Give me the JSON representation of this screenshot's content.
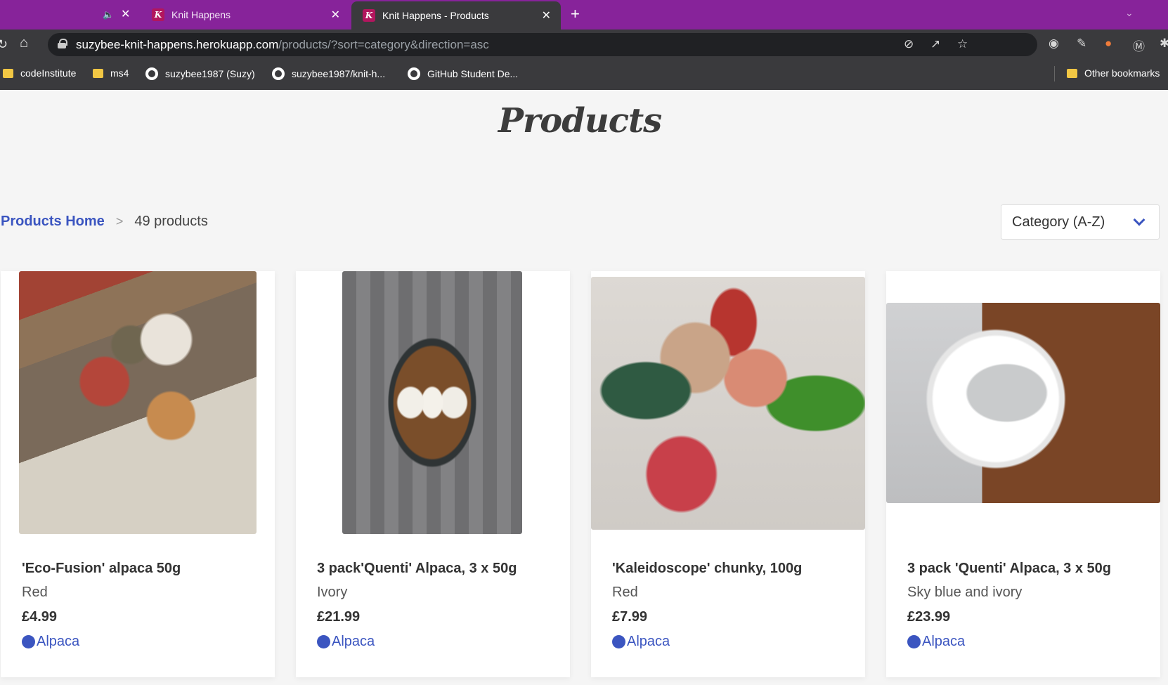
{
  "browser": {
    "tabs": [
      {
        "title": "",
        "active": false,
        "muted": true
      },
      {
        "title": "Knit Happens",
        "active": false
      },
      {
        "title": "Knit Happens - Products",
        "active": true
      }
    ],
    "favicon_letter": "K",
    "address": {
      "host": "suzybee-knit-happens.herokuapp.com",
      "path": "/products/?sort=category&direction=asc"
    },
    "bookmarks": [
      {
        "label": "codeInstitute",
        "icon": "folder-icon"
      },
      {
        "label": "ms4",
        "icon": "folder-icon"
      },
      {
        "label": "suzybee1987 (Suzy)",
        "icon": "github-icon"
      },
      {
        "label": "suzybee1987/knit-h...",
        "icon": "github-icon"
      },
      {
        "label": "GitHub Student De...",
        "icon": "github-icon"
      }
    ],
    "other_bookmarks": "Other bookmarks"
  },
  "page": {
    "title": "Products",
    "breadcrumb": {
      "home": "Products Home",
      "separator": ">",
      "count": "49 products"
    },
    "sort": {
      "selected": "Category (A-Z)"
    },
    "products": [
      {
        "name": "'Eco-Fusion' alpaca 50g",
        "color": "Red",
        "price": "£4.99",
        "category": "Alpaca"
      },
      {
        "name": "3 pack'Quenti' Alpaca, 3 x 50g",
        "color": "Ivory",
        "price": "£21.99",
        "category": "Alpaca"
      },
      {
        "name": "'Kaleidoscope' chunky, 100g",
        "color": "Red",
        "price": "£7.99",
        "category": "Alpaca"
      },
      {
        "name": "3 pack 'Quenti' Alpaca, 3 x 50g",
        "color": "Sky blue and ivory",
        "price": "£23.99",
        "category": "Alpaca"
      }
    ],
    "accent_color": "#3b55c0",
    "tabbar_color": "#87239a"
  }
}
